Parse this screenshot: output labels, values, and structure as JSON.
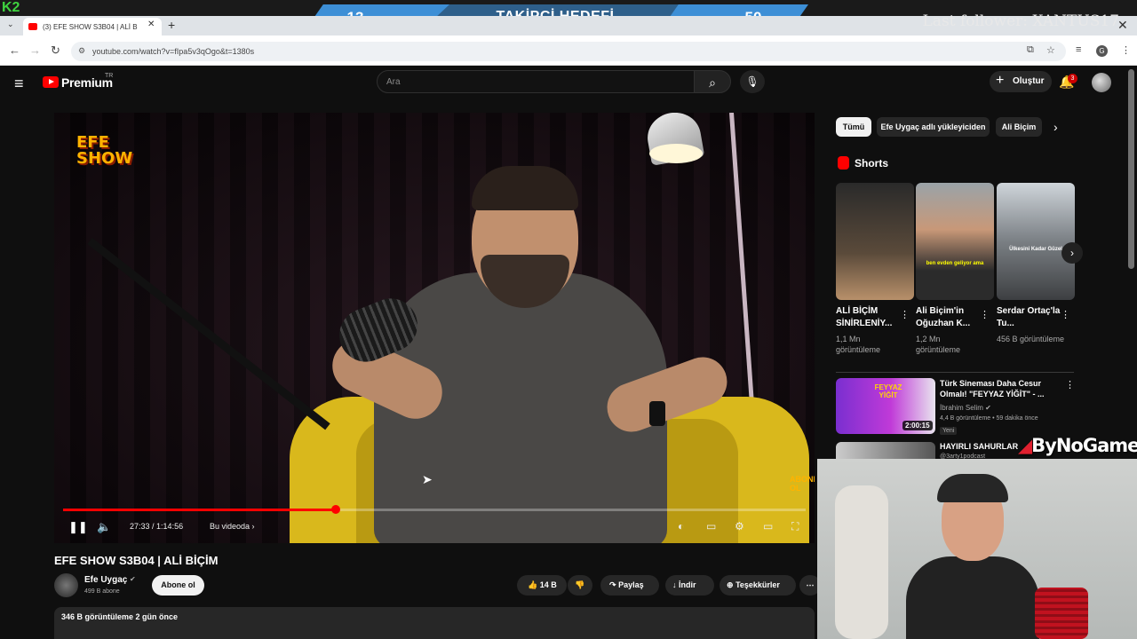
{
  "overlay": {
    "brand": "K2",
    "goal_current": "13",
    "goal_title": "TAKİPÇİ HEDEFİ",
    "goal_target": "50",
    "last_follower": "Last follower: XANTUS17",
    "sponsor": "ByNoGame",
    "colors": {
      "goal_bar": "#3d8fd6",
      "goal_mid": "#2e5f8a"
    }
  },
  "browser": {
    "tab_title": "(3) EFE SHOW S3B04 | ALİ B",
    "url": "youtube.com/watch?v=fIpa5v3qOgo&t=1380s"
  },
  "youtube": {
    "logo_text": "Premium",
    "logo_region": "TR",
    "search_placeholder": "Ara",
    "create_label": "Oluştur",
    "notification_count": "3",
    "accent": "#ff0000"
  },
  "player": {
    "show_logo": "EFE SHOW",
    "watermark": "ABONE OL",
    "current_time": "27:33",
    "duration": "1:14:56",
    "time_separator": " / ",
    "chapter_label": "Bu videoda",
    "progress_fraction": 0.367
  },
  "video": {
    "title": "EFE SHOW S3B04 | ALİ BİÇİM",
    "channel_name": "Efe Uygaç",
    "subscribers": "499 B abone",
    "subscribe_label": "Abone ol",
    "likes": "14 B",
    "share_label": "Paylaş",
    "download_label": "İndir",
    "thanks_label": "Teşekkürler",
    "views_line": "346 B görüntüleme  2 gün önce"
  },
  "sidebar": {
    "chips": [
      "Tümü",
      "Efe Uygaç adlı yükleyiciden",
      "Ali Biçim"
    ],
    "shorts_title": "Shorts",
    "shorts": [
      {
        "title": "ALİ BİÇİM SİNİRLENİY...",
        "views": "1,1 Mn görüntüleme",
        "caption": ""
      },
      {
        "title": "Ali Biçim'in Oğuzhan K...",
        "views": "1,2 Mn görüntüleme",
        "caption": "ben evden geliyor ama"
      },
      {
        "title": "Serdar Ortaç'la Tu...",
        "views": "456 B görüntüleme",
        "caption": "Ülkesini Kadar Güzel"
      }
    ],
    "recommendation": {
      "title": "Türk Sineması Daha Cesur Olmalı! \"FEYYAZ YİĞİT\" - ...",
      "channel": "İbrahim Selim",
      "meta": "4,4 B görüntüleme • 59 dakika önce",
      "badge": "Yeni",
      "duration": "2:00:15",
      "thumb_text": "FEYYAZ YİĞİT"
    },
    "recommendation2": {
      "title": "HAYIRLI SAHURLAR",
      "channel": "@3arty1podcast"
    }
  }
}
